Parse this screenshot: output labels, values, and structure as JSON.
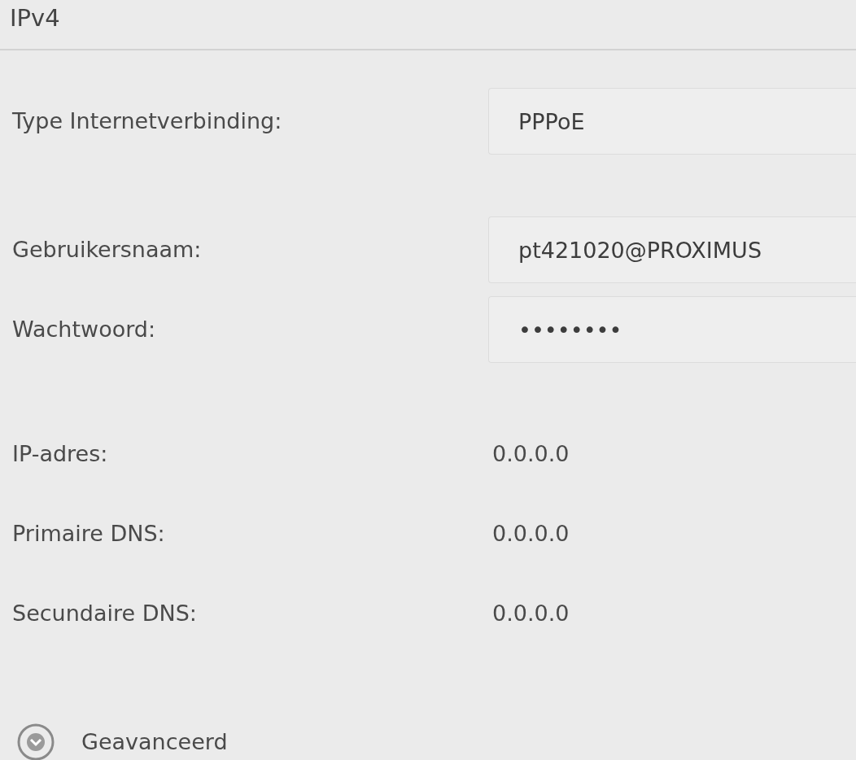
{
  "section_title": "IPv4",
  "fields": [
    {
      "label": "Type Internetverbinding:",
      "value": "PPPoE"
    },
    {
      "label": "Gebruikersnaam:",
      "value": "pt421020@PROXIMUS"
    },
    {
      "label": "Wachtwoord:",
      "value": "••••••••"
    }
  ],
  "info": [
    {
      "label": "IP-adres:",
      "value": "0.0.0.0"
    },
    {
      "label": "Primaire DNS:",
      "value": "0.0.0.0"
    },
    {
      "label": "Secundaire DNS:",
      "value": "0.0.0.0"
    }
  ],
  "advanced": {
    "label": "Geavanceerd",
    "expanded": false
  }
}
